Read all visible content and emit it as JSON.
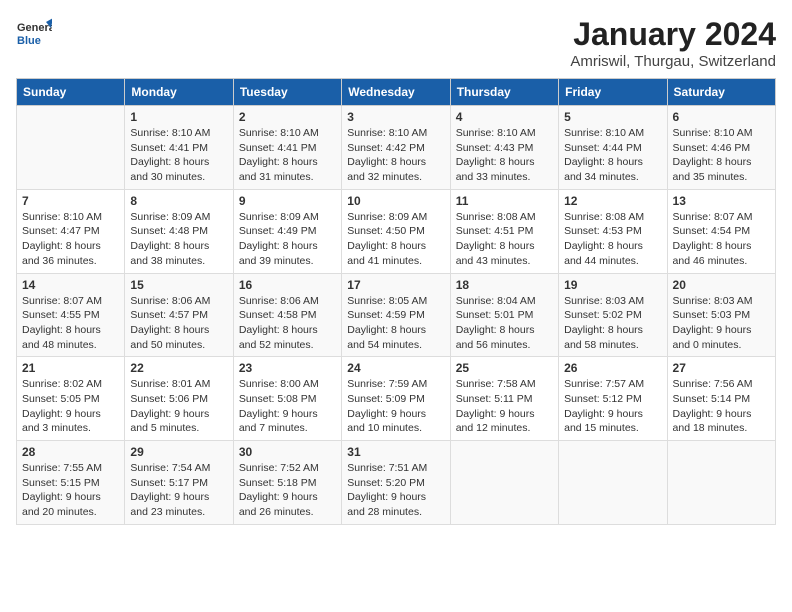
{
  "logo": {
    "general": "General",
    "blue": "Blue"
  },
  "title": "January 2024",
  "subtitle": "Amriswil, Thurgau, Switzerland",
  "days_of_week": [
    "Sunday",
    "Monday",
    "Tuesday",
    "Wednesday",
    "Thursday",
    "Friday",
    "Saturday"
  ],
  "weeks": [
    [
      {
        "num": "",
        "info": ""
      },
      {
        "num": "1",
        "info": "Sunrise: 8:10 AM\nSunset: 4:41 PM\nDaylight: 8 hours\nand 30 minutes."
      },
      {
        "num": "2",
        "info": "Sunrise: 8:10 AM\nSunset: 4:41 PM\nDaylight: 8 hours\nand 31 minutes."
      },
      {
        "num": "3",
        "info": "Sunrise: 8:10 AM\nSunset: 4:42 PM\nDaylight: 8 hours\nand 32 minutes."
      },
      {
        "num": "4",
        "info": "Sunrise: 8:10 AM\nSunset: 4:43 PM\nDaylight: 8 hours\nand 33 minutes."
      },
      {
        "num": "5",
        "info": "Sunrise: 8:10 AM\nSunset: 4:44 PM\nDaylight: 8 hours\nand 34 minutes."
      },
      {
        "num": "6",
        "info": "Sunrise: 8:10 AM\nSunset: 4:46 PM\nDaylight: 8 hours\nand 35 minutes."
      }
    ],
    [
      {
        "num": "7",
        "info": "Sunrise: 8:10 AM\nSunset: 4:47 PM\nDaylight: 8 hours\nand 36 minutes."
      },
      {
        "num": "8",
        "info": "Sunrise: 8:09 AM\nSunset: 4:48 PM\nDaylight: 8 hours\nand 38 minutes."
      },
      {
        "num": "9",
        "info": "Sunrise: 8:09 AM\nSunset: 4:49 PM\nDaylight: 8 hours\nand 39 minutes."
      },
      {
        "num": "10",
        "info": "Sunrise: 8:09 AM\nSunset: 4:50 PM\nDaylight: 8 hours\nand 41 minutes."
      },
      {
        "num": "11",
        "info": "Sunrise: 8:08 AM\nSunset: 4:51 PM\nDaylight: 8 hours\nand 43 minutes."
      },
      {
        "num": "12",
        "info": "Sunrise: 8:08 AM\nSunset: 4:53 PM\nDaylight: 8 hours\nand 44 minutes."
      },
      {
        "num": "13",
        "info": "Sunrise: 8:07 AM\nSunset: 4:54 PM\nDaylight: 8 hours\nand 46 minutes."
      }
    ],
    [
      {
        "num": "14",
        "info": "Sunrise: 8:07 AM\nSunset: 4:55 PM\nDaylight: 8 hours\nand 48 minutes."
      },
      {
        "num": "15",
        "info": "Sunrise: 8:06 AM\nSunset: 4:57 PM\nDaylight: 8 hours\nand 50 minutes."
      },
      {
        "num": "16",
        "info": "Sunrise: 8:06 AM\nSunset: 4:58 PM\nDaylight: 8 hours\nand 52 minutes."
      },
      {
        "num": "17",
        "info": "Sunrise: 8:05 AM\nSunset: 4:59 PM\nDaylight: 8 hours\nand 54 minutes."
      },
      {
        "num": "18",
        "info": "Sunrise: 8:04 AM\nSunset: 5:01 PM\nDaylight: 8 hours\nand 56 minutes."
      },
      {
        "num": "19",
        "info": "Sunrise: 8:03 AM\nSunset: 5:02 PM\nDaylight: 8 hours\nand 58 minutes."
      },
      {
        "num": "20",
        "info": "Sunrise: 8:03 AM\nSunset: 5:03 PM\nDaylight: 9 hours\nand 0 minutes."
      }
    ],
    [
      {
        "num": "21",
        "info": "Sunrise: 8:02 AM\nSunset: 5:05 PM\nDaylight: 9 hours\nand 3 minutes."
      },
      {
        "num": "22",
        "info": "Sunrise: 8:01 AM\nSunset: 5:06 PM\nDaylight: 9 hours\nand 5 minutes."
      },
      {
        "num": "23",
        "info": "Sunrise: 8:00 AM\nSunset: 5:08 PM\nDaylight: 9 hours\nand 7 minutes."
      },
      {
        "num": "24",
        "info": "Sunrise: 7:59 AM\nSunset: 5:09 PM\nDaylight: 9 hours\nand 10 minutes."
      },
      {
        "num": "25",
        "info": "Sunrise: 7:58 AM\nSunset: 5:11 PM\nDaylight: 9 hours\nand 12 minutes."
      },
      {
        "num": "26",
        "info": "Sunrise: 7:57 AM\nSunset: 5:12 PM\nDaylight: 9 hours\nand 15 minutes."
      },
      {
        "num": "27",
        "info": "Sunrise: 7:56 AM\nSunset: 5:14 PM\nDaylight: 9 hours\nand 18 minutes."
      }
    ],
    [
      {
        "num": "28",
        "info": "Sunrise: 7:55 AM\nSunset: 5:15 PM\nDaylight: 9 hours\nand 20 minutes."
      },
      {
        "num": "29",
        "info": "Sunrise: 7:54 AM\nSunset: 5:17 PM\nDaylight: 9 hours\nand 23 minutes."
      },
      {
        "num": "30",
        "info": "Sunrise: 7:52 AM\nSunset: 5:18 PM\nDaylight: 9 hours\nand 26 minutes."
      },
      {
        "num": "31",
        "info": "Sunrise: 7:51 AM\nSunset: 5:20 PM\nDaylight: 9 hours\nand 28 minutes."
      },
      {
        "num": "",
        "info": ""
      },
      {
        "num": "",
        "info": ""
      },
      {
        "num": "",
        "info": ""
      }
    ]
  ]
}
